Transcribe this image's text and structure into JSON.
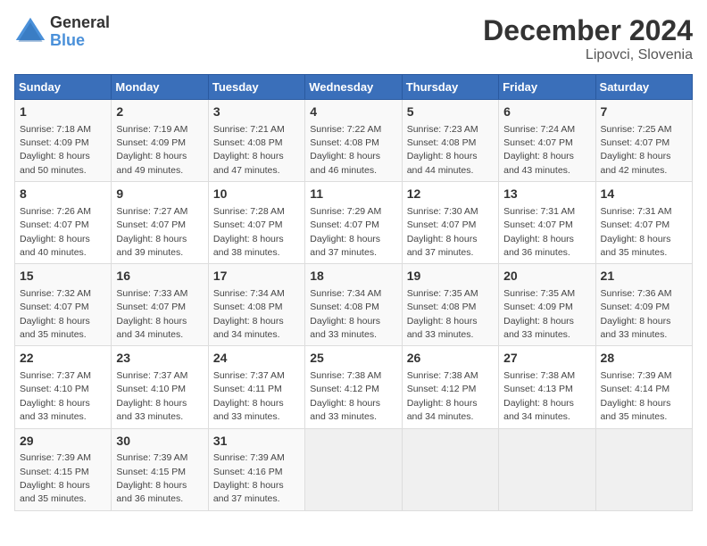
{
  "header": {
    "logo_line1": "General",
    "logo_line2": "Blue",
    "title": "December 2024",
    "subtitle": "Lipovci, Slovenia"
  },
  "columns": [
    "Sunday",
    "Monday",
    "Tuesday",
    "Wednesday",
    "Thursday",
    "Friday",
    "Saturday"
  ],
  "weeks": [
    [
      {
        "day": "1",
        "sunrise": "7:18 AM",
        "sunset": "4:09 PM",
        "daylight": "8 hours and 50 minutes."
      },
      {
        "day": "2",
        "sunrise": "7:19 AM",
        "sunset": "4:09 PM",
        "daylight": "8 hours and 49 minutes."
      },
      {
        "day": "3",
        "sunrise": "7:21 AM",
        "sunset": "4:08 PM",
        "daylight": "8 hours and 47 minutes."
      },
      {
        "day": "4",
        "sunrise": "7:22 AM",
        "sunset": "4:08 PM",
        "daylight": "8 hours and 46 minutes."
      },
      {
        "day": "5",
        "sunrise": "7:23 AM",
        "sunset": "4:08 PM",
        "daylight": "8 hours and 44 minutes."
      },
      {
        "day": "6",
        "sunrise": "7:24 AM",
        "sunset": "4:07 PM",
        "daylight": "8 hours and 43 minutes."
      },
      {
        "day": "7",
        "sunrise": "7:25 AM",
        "sunset": "4:07 PM",
        "daylight": "8 hours and 42 minutes."
      }
    ],
    [
      {
        "day": "8",
        "sunrise": "7:26 AM",
        "sunset": "4:07 PM",
        "daylight": "8 hours and 40 minutes."
      },
      {
        "day": "9",
        "sunrise": "7:27 AM",
        "sunset": "4:07 PM",
        "daylight": "8 hours and 39 minutes."
      },
      {
        "day": "10",
        "sunrise": "7:28 AM",
        "sunset": "4:07 PM",
        "daylight": "8 hours and 38 minutes."
      },
      {
        "day": "11",
        "sunrise": "7:29 AM",
        "sunset": "4:07 PM",
        "daylight": "8 hours and 37 minutes."
      },
      {
        "day": "12",
        "sunrise": "7:30 AM",
        "sunset": "4:07 PM",
        "daylight": "8 hours and 37 minutes."
      },
      {
        "day": "13",
        "sunrise": "7:31 AM",
        "sunset": "4:07 PM",
        "daylight": "8 hours and 36 minutes."
      },
      {
        "day": "14",
        "sunrise": "7:31 AM",
        "sunset": "4:07 PM",
        "daylight": "8 hours and 35 minutes."
      }
    ],
    [
      {
        "day": "15",
        "sunrise": "7:32 AM",
        "sunset": "4:07 PM",
        "daylight": "8 hours and 35 minutes."
      },
      {
        "day": "16",
        "sunrise": "7:33 AM",
        "sunset": "4:07 PM",
        "daylight": "8 hours and 34 minutes."
      },
      {
        "day": "17",
        "sunrise": "7:34 AM",
        "sunset": "4:08 PM",
        "daylight": "8 hours and 34 minutes."
      },
      {
        "day": "18",
        "sunrise": "7:34 AM",
        "sunset": "4:08 PM",
        "daylight": "8 hours and 33 minutes."
      },
      {
        "day": "19",
        "sunrise": "7:35 AM",
        "sunset": "4:08 PM",
        "daylight": "8 hours and 33 minutes."
      },
      {
        "day": "20",
        "sunrise": "7:35 AM",
        "sunset": "4:09 PM",
        "daylight": "8 hours and 33 minutes."
      },
      {
        "day": "21",
        "sunrise": "7:36 AM",
        "sunset": "4:09 PM",
        "daylight": "8 hours and 33 minutes."
      }
    ],
    [
      {
        "day": "22",
        "sunrise": "7:37 AM",
        "sunset": "4:10 PM",
        "daylight": "8 hours and 33 minutes."
      },
      {
        "day": "23",
        "sunrise": "7:37 AM",
        "sunset": "4:10 PM",
        "daylight": "8 hours and 33 minutes."
      },
      {
        "day": "24",
        "sunrise": "7:37 AM",
        "sunset": "4:11 PM",
        "daylight": "8 hours and 33 minutes."
      },
      {
        "day": "25",
        "sunrise": "7:38 AM",
        "sunset": "4:12 PM",
        "daylight": "8 hours and 33 minutes."
      },
      {
        "day": "26",
        "sunrise": "7:38 AM",
        "sunset": "4:12 PM",
        "daylight": "8 hours and 34 minutes."
      },
      {
        "day": "27",
        "sunrise": "7:38 AM",
        "sunset": "4:13 PM",
        "daylight": "8 hours and 34 minutes."
      },
      {
        "day": "28",
        "sunrise": "7:39 AM",
        "sunset": "4:14 PM",
        "daylight": "8 hours and 35 minutes."
      }
    ],
    [
      {
        "day": "29",
        "sunrise": "7:39 AM",
        "sunset": "4:15 PM",
        "daylight": "8 hours and 35 minutes."
      },
      {
        "day": "30",
        "sunrise": "7:39 AM",
        "sunset": "4:15 PM",
        "daylight": "8 hours and 36 minutes."
      },
      {
        "day": "31",
        "sunrise": "7:39 AM",
        "sunset": "4:16 PM",
        "daylight": "8 hours and 37 minutes."
      },
      null,
      null,
      null,
      null
    ]
  ]
}
